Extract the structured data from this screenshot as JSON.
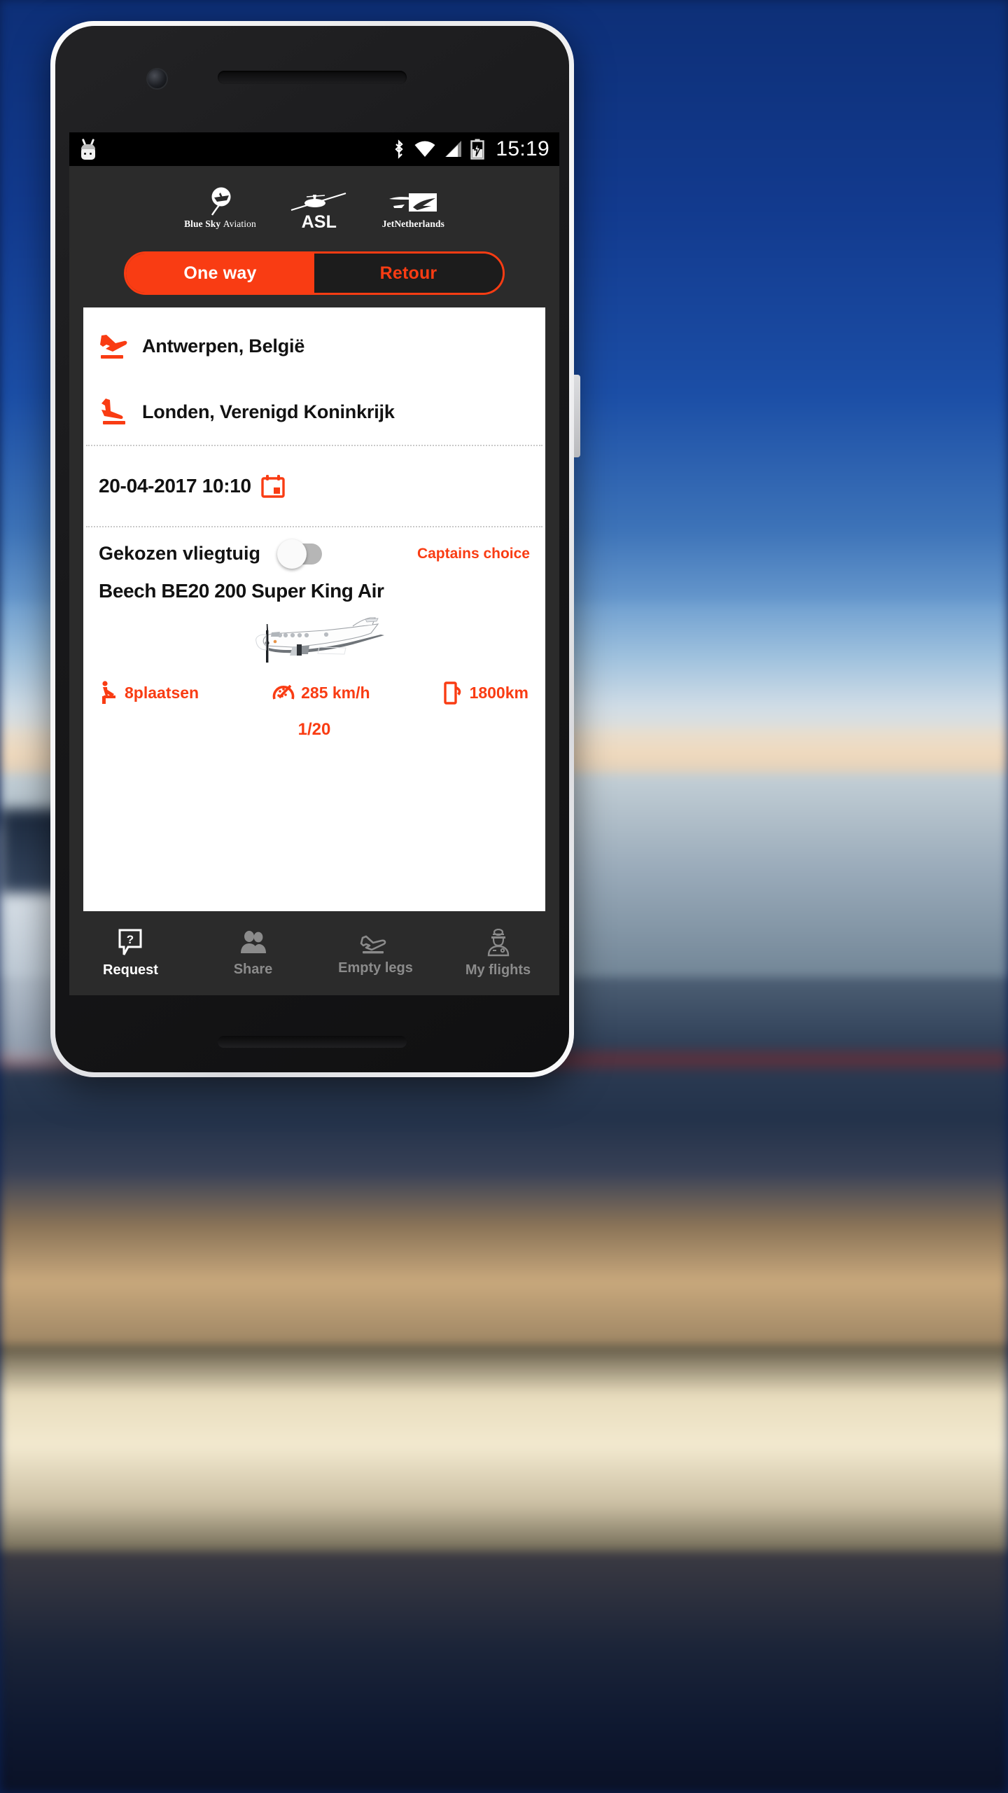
{
  "status_bar": {
    "icons": [
      "android-icon",
      "bluetooth-icon",
      "wifi-icon",
      "cell-signal-icon",
      "battery-charging-icon"
    ],
    "time": "15:19"
  },
  "logos": [
    {
      "name": "Blue Sky",
      "sub": "Aviation",
      "icon": "blue-sky-aviation-logo"
    },
    {
      "name": "ASL",
      "sub": "",
      "icon": "asl-logo"
    },
    {
      "name": "JetNetherlands",
      "sub": "",
      "icon": "jetnetherlands-logo"
    }
  ],
  "trip_type": {
    "one_way_label": "One way",
    "retour_label": "Retour",
    "selected": "One way"
  },
  "route": {
    "departure": {
      "icon": "takeoff-icon",
      "value": "Antwerpen, België"
    },
    "arrival": {
      "icon": "landing-icon",
      "value": "Londen, Verenigd Koninkrijk"
    }
  },
  "date": {
    "value": "20-04-2017 10:10",
    "icon": "calendar-icon"
  },
  "aircraft": {
    "section_label": "Gekozen vliegtuig",
    "toggle_state": "off",
    "captains_choice_label": "Captains choice",
    "name": "Beech BE20 200 Super King Air",
    "image": "turboprop-side-view",
    "specs": [
      {
        "icon": "seat-icon",
        "value": "8plaatsen"
      },
      {
        "icon": "speedometer-icon",
        "value": "285 km/h"
      },
      {
        "icon": "range-icon",
        "value": "1800km"
      }
    ],
    "pager": "1/20"
  },
  "bottom_nav": [
    {
      "label": "Request",
      "icon": "question-bubble-icon",
      "active": true
    },
    {
      "label": "Share",
      "icon": "people-icon",
      "active": false
    },
    {
      "label": "Empty legs",
      "icon": "plane-takeoff-icon",
      "active": false
    },
    {
      "label": "My flights",
      "icon": "pilot-icon",
      "active": false
    }
  ],
  "colors": {
    "accent": "#f93c13",
    "screen_bg": "#2b2b2b",
    "card_bg": "#ffffff",
    "status_bg": "#000000",
    "dim_text": "#8b8b8b"
  }
}
